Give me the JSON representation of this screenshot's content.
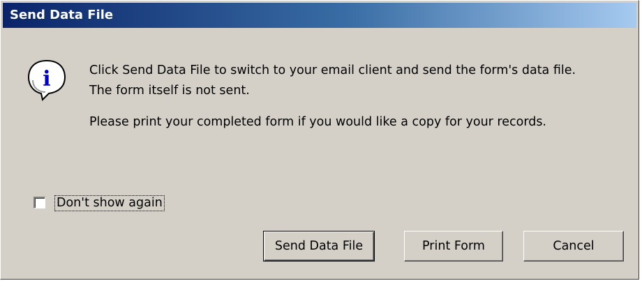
{
  "window": {
    "title": "Send Data File"
  },
  "icon": {
    "name": "information-icon",
    "glyph": "i"
  },
  "message": {
    "line1": "Click Send Data File to switch to your email client and send the form's data file.",
    "line2": "The form itself is not sent.",
    "line3": "Please print your completed form if you would like a copy for your records."
  },
  "checkbox": {
    "label": "Don't show again",
    "checked": false
  },
  "buttons": {
    "send_label": "Send Data File",
    "print_label": "Print Form",
    "cancel_label": "Cancel"
  },
  "colors": {
    "titlebar_start": "#0a246a",
    "titlebar_end": "#a6caf0",
    "dialog_bg": "#d4d0c8",
    "icon_blue": "#0000cc"
  }
}
